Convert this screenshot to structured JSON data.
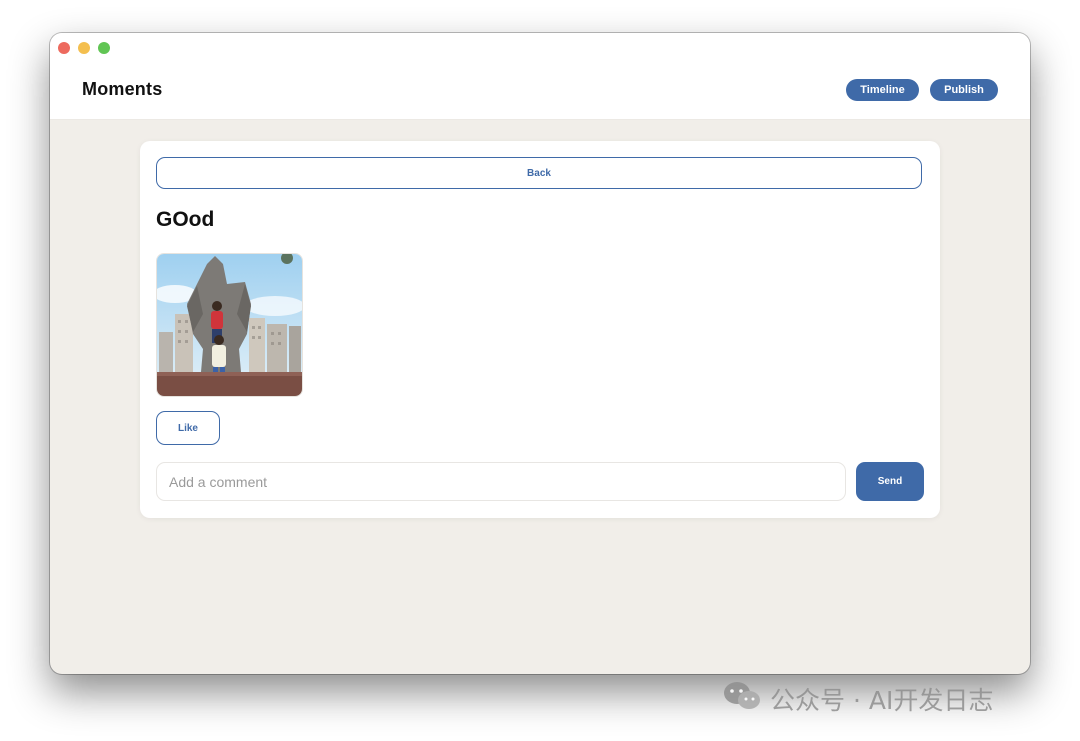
{
  "header": {
    "title": "Moments",
    "nav": {
      "timeline_label": "Timeline",
      "publish_label": "Publish"
    }
  },
  "post": {
    "back_label": "Back",
    "title": "GOod",
    "like_label": "Like",
    "comment": {
      "placeholder": "Add a comment",
      "value": ""
    },
    "send_label": "Send"
  },
  "watermark": {
    "text": "公众号 · AI开发日志",
    "icon": "wechat-icon"
  },
  "colors": {
    "accent": "#3f6aa8",
    "background": "#f1eee9",
    "card": "#ffffff"
  }
}
